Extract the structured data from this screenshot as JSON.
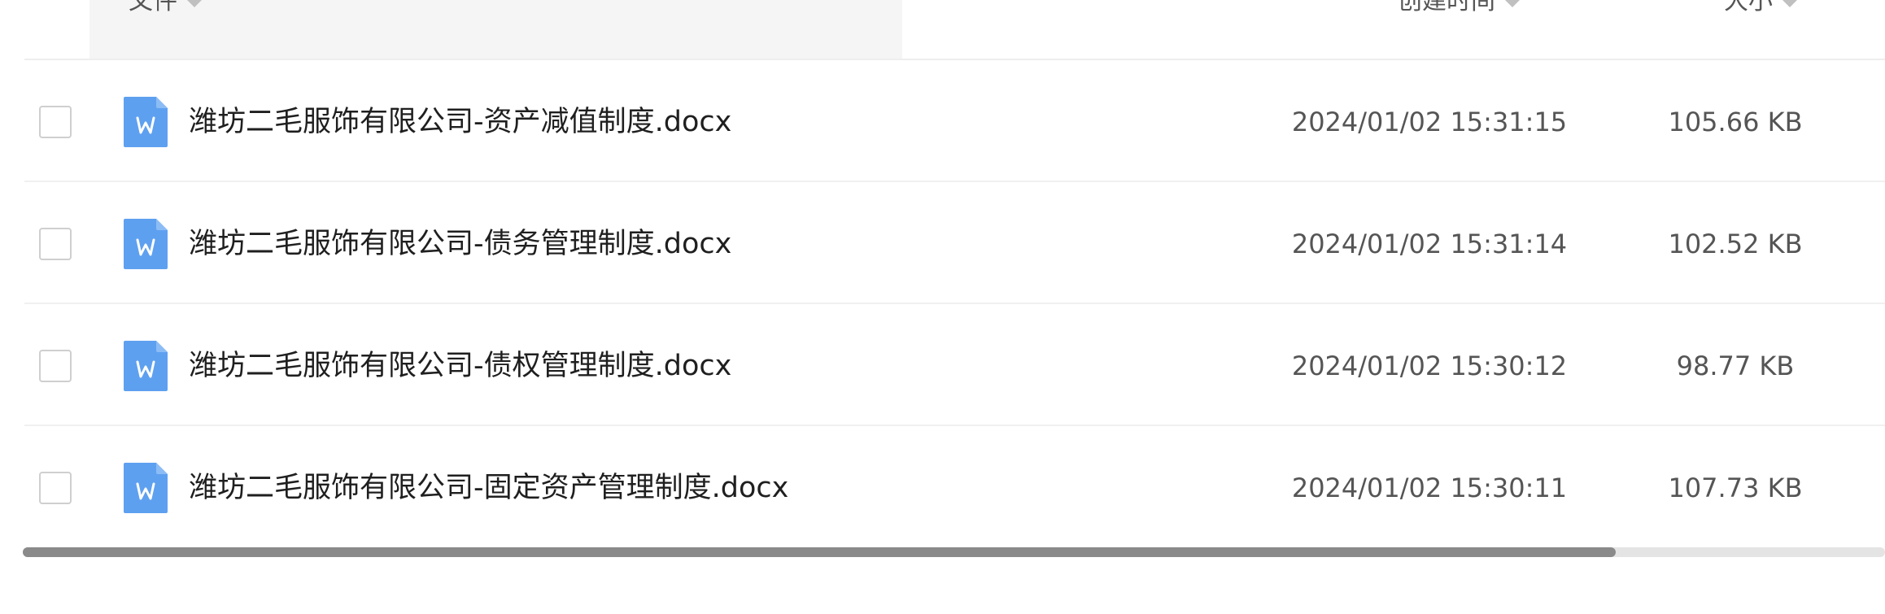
{
  "header": {
    "file_label": "文件",
    "time_label": "创建时间",
    "size_label": "大小"
  },
  "rows": [
    {
      "name": "潍坊二毛服饰有限公司-资产减值制度.docx",
      "created": "2024/01/02 15:31:15",
      "size": "105.66 KB",
      "icon": "word-doc-icon"
    },
    {
      "name": "潍坊二毛服饰有限公司-债务管理制度.docx",
      "created": "2024/01/02 15:31:14",
      "size": "102.52 KB",
      "icon": "word-doc-icon"
    },
    {
      "name": "潍坊二毛服饰有限公司-债权管理制度.docx",
      "created": "2024/01/02 15:30:12",
      "size": "98.77 KB",
      "icon": "word-doc-icon"
    },
    {
      "name": "潍坊二毛服饰有限公司-固定资产管理制度.docx",
      "created": "2024/01/02 15:30:11",
      "size": "107.73 KB",
      "icon": "word-doc-icon"
    }
  ],
  "colors": {
    "icon_blue": "#5ea0f0",
    "header_bg": "#f5f5f5",
    "scroll_thumb": "#8a8a8a"
  }
}
